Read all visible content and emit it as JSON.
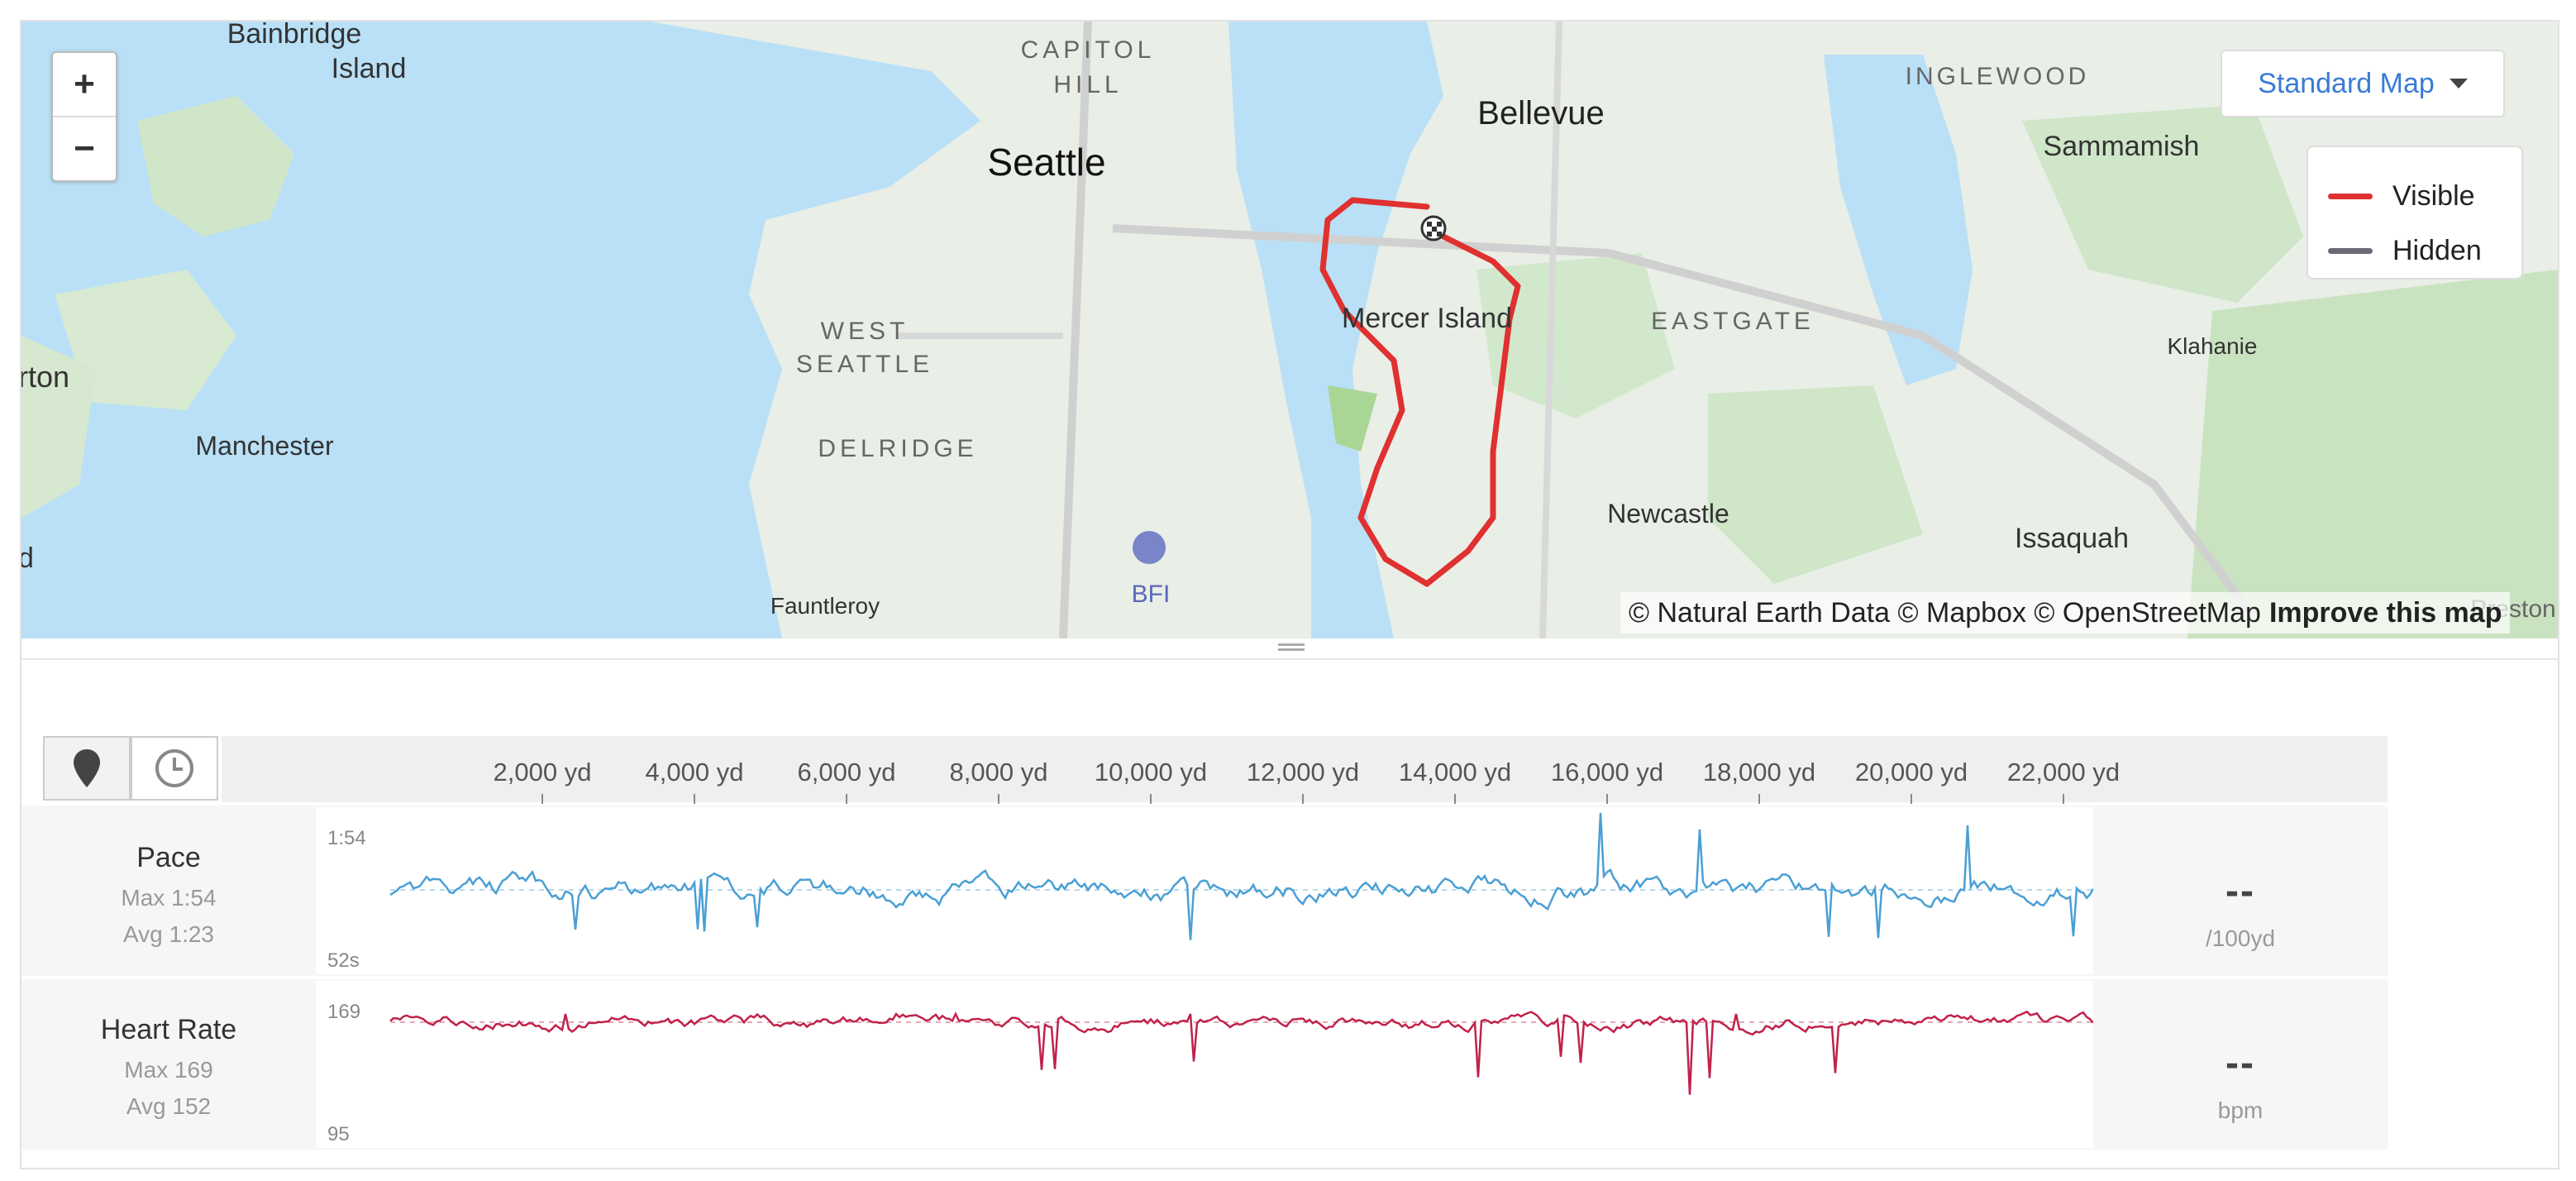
{
  "map": {
    "zoom_in": "+",
    "zoom_out": "−",
    "style_selector": "Standard Map",
    "legend": [
      {
        "label": "Visible",
        "color": "#e03030"
      },
      {
        "label": "Hidden",
        "color": "#6b6b78"
      }
    ],
    "attribution": "© Natural Earth Data © Mapbox © OpenStreetMap",
    "improve_link": "Improve this map",
    "places": [
      "Bainbridge Island",
      "CAPITOL HILL",
      "Seattle",
      "Bellevue",
      "INGLEWOOD",
      "Sammamish",
      "Mercer Island",
      "EASTGATE",
      "Klahanie",
      "WEST SEATTLE",
      "DELRIDGE",
      "Manchester",
      "Newcastle",
      "Issaquah",
      "Fauntleroy",
      "BFI",
      "Preston",
      "rton",
      "d"
    ],
    "route_color": "#e03030"
  },
  "tabs": [
    {
      "icon": "map-pin-icon"
    },
    {
      "icon": "clock-icon"
    }
  ],
  "x_axis": {
    "ticks": [
      "2,000 yd",
      "4,000 yd",
      "6,000 yd",
      "8,000 yd",
      "10,000 yd",
      "12,000 yd",
      "14,000 yd",
      "16,000 yd",
      "18,000 yd",
      "20,000 yd",
      "22,000 yd"
    ]
  },
  "streams": {
    "pace": {
      "name": "Pace",
      "max": "Max 1:54",
      "avg": "Avg 1:23",
      "y_top": "1:54",
      "y_bottom": "52s",
      "value": "--",
      "unit": "/100yd",
      "color": "#4a9fd4"
    },
    "heart_rate": {
      "name": "Heart Rate",
      "max": "Max 169",
      "avg": "Avg 152",
      "y_top": "169",
      "y_bottom": "95",
      "value": "--",
      "unit": "bpm",
      "color": "#c0224a"
    }
  }
}
